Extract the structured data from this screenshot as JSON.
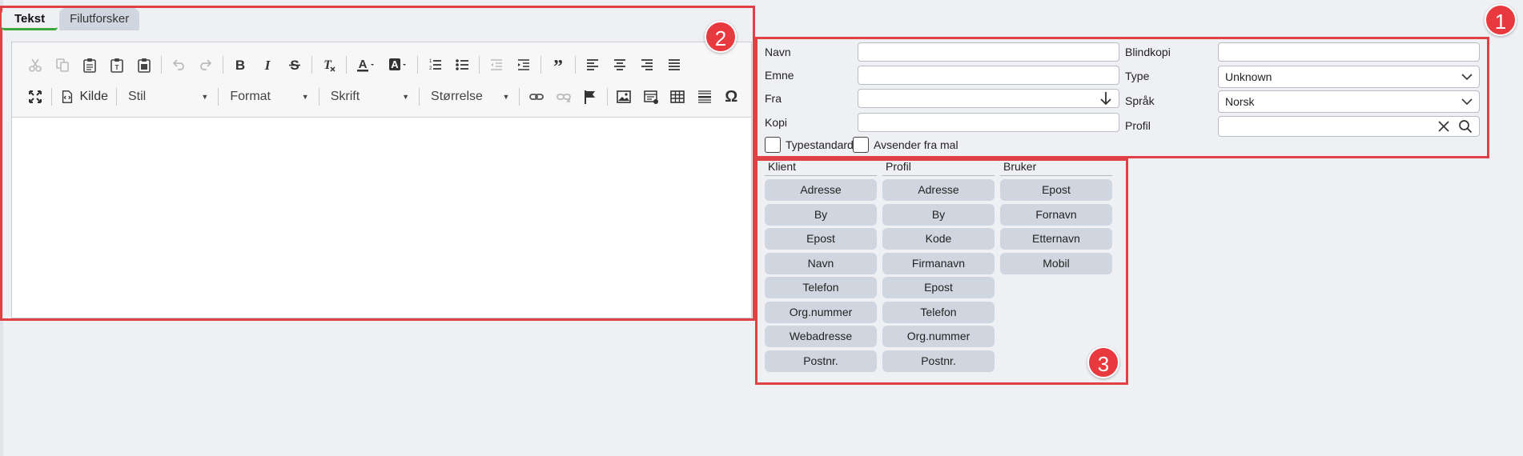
{
  "tabs": [
    {
      "label": "Tekst",
      "active": true
    },
    {
      "label": "Filutforsker",
      "active": false
    }
  ],
  "toolbar": {
    "source_label": "Kilde",
    "style_combo": "Stil",
    "format_combo": "Format",
    "font_combo": "Skrift",
    "size_combo": "Størrelse"
  },
  "form": {
    "navn_label": "Navn",
    "navn_value": "",
    "emne_label": "Emne",
    "emne_value": "",
    "fra_label": "Fra",
    "fra_value": "",
    "kopi_label": "Kopi",
    "kopi_value": "",
    "blindkopi_label": "Blindkopi",
    "blindkopi_value": "",
    "type_label": "Type",
    "type_value": "Unknown",
    "sprak_label": "Språk",
    "sprak_value": "Norsk",
    "profil_label": "Profil",
    "profil_value": "",
    "typestandard_label": "Typestandard",
    "avsender_label": "Avsender fra mal"
  },
  "merge_fields": {
    "klient": {
      "header": "Klient",
      "items": [
        "Adresse",
        "By",
        "Epost",
        "Navn",
        "Telefon",
        "Org.nummer",
        "Webadresse",
        "Postnr."
      ]
    },
    "profil": {
      "header": "Profil",
      "items": [
        "Adresse",
        "By",
        "Kode",
        "Firmanavn",
        "Epost",
        "Telefon",
        "Org.nummer",
        "Postnr."
      ]
    },
    "bruker": {
      "header": "Bruker",
      "items": [
        "Epost",
        "Fornavn",
        "Etternavn",
        "Mobil"
      ]
    }
  },
  "annotations": {
    "badge1": "1",
    "badge2": "2",
    "badge3": "3",
    "color": "#e04147"
  },
  "colors": {
    "accent_tab_underline": "#3aa83a",
    "field_button_bg": "#d0d6df",
    "page_bg": "#eff0f4"
  }
}
